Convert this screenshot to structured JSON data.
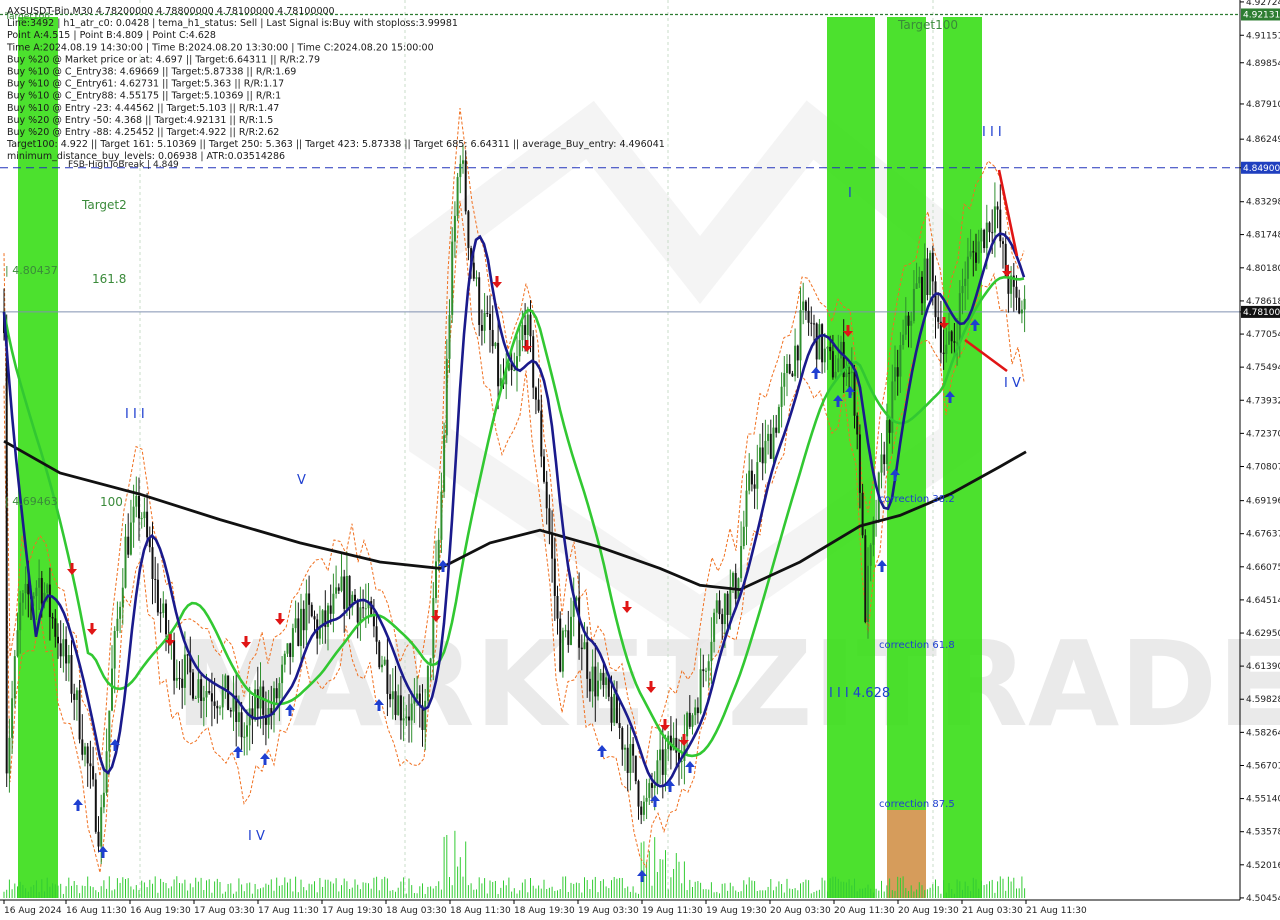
{
  "header": {
    "info_lines": [
      "AXSUSDT-Bin,M30  4.78200000 4.78800000 4.78100000 4.78100000",
      "Line:3492 | h1_atr_c0: 0.0428 | tema_h1_status: Sell | Last Signal is:Buy with stoploss:3.99981",
      "Point A:4.515 | Point B:4.809 | Point C:4.628",
      "Time A:2024.08.19 14:30:00 | Time B:2024.08.20 13:30:00 | Time C:2024.08.20 15:00:00",
      "Buy %20 @ Market price or at: 4.697 || Target:6.64311 || R/R:2.79",
      "Buy %10 @ C_Entry38: 4.69669 || Target:5.87338 || R/R:1.69",
      "Buy %10 @ C_Entry61: 4.62731 || Target:5.363 || R/R:1.17",
      "Buy %10 @ C_Entry88: 4.55175 || Target:5.10369 || R/R:1",
      "Buy %10 @ Entry -23: 4.44562 || Target:5.103 || R/R:1.47",
      "Buy %20 @ Entry -50: 4.368 || Target:4.92131 || R/R:1.5",
      "Buy %20 @ Entry -88: 4.25452 || Target:4.922 || R/R:2.62",
      "Target100: 4.922 || Target 161: 5.10369 || Target 250: 5.363 || Target 423: 5.87338 || Target 685: 6.64311 || average_Buy_entry: 4.496041",
      "minimum_distance_buy_levels: 0.06938 | ATR:0.03514286"
    ]
  },
  "chart_data": {
    "type": "candlestick",
    "symbol": "AXSUSDT-Bin",
    "timeframe": "M30",
    "ylim": [
      4.5045,
      4.9272
    ],
    "y_ticks": [
      "4.92724",
      "4.91151",
      "4.89854",
      "4.87910",
      "4.86249",
      "4.84900",
      "4.83298",
      "4.81748",
      "4.80180",
      "4.78618",
      "4.78100",
      "4.77054",
      "4.75494",
      "4.73932",
      "4.72370",
      "4.70807",
      "4.69196",
      "4.67637",
      "4.66075",
      "4.64514",
      "4.62950",
      "4.61390",
      "4.59828",
      "4.58264",
      "4.56701",
      "4.55140",
      "4.53578",
      "4.52016",
      "4.50454"
    ],
    "x_ticks": [
      "16 Aug 2024",
      "16 Aug 11:30",
      "16 Aug 19:30",
      "17 Aug 03:30",
      "17 Aug 11:30",
      "17 Aug 19:30",
      "18 Aug 03:30",
      "18 Aug 11:30",
      "18 Aug 19:30",
      "19 Aug 03:30",
      "19 Aug 11:30",
      "19 Aug 19:30",
      "20 Aug 03:30",
      "20 Aug 11:30",
      "20 Aug 19:30",
      "21 Aug 03:30",
      "21 Aug 11:30"
    ],
    "current_price": "4.78100",
    "highlighted_prices": [
      {
        "value": 4.92131,
        "label": "4.92131",
        "color": "#2e7d32"
      },
      {
        "value": 4.849,
        "label": "4.84900",
        "color": "#1f3fbf"
      }
    ],
    "levels": [
      {
        "label": "Target100",
        "value": "4.922"
      },
      {
        "label": "FSB-HighToBreak | 4.849",
        "value": "4.849"
      },
      {
        "label": "Target2",
        "value": "4.829"
      },
      {
        "label": "| 4.80437",
        "value": "4.80437"
      },
      {
        "label": "161.8",
        "value": "4.796"
      },
      {
        "label": "| 4.69463",
        "value": "4.69463"
      },
      {
        "label": "100",
        "value": "4.694"
      }
    ],
    "annotations": [
      {
        "text": "I I I",
        "kind": "wave"
      },
      {
        "text": "V",
        "kind": "wave"
      },
      {
        "text": "I V",
        "kind": "wave"
      },
      {
        "text": "I",
        "kind": "wave"
      },
      {
        "text": "I I I",
        "kind": "wave"
      },
      {
        "text": "I V",
        "kind": "wave"
      },
      {
        "text": "I I I 4.628",
        "kind": "wave"
      },
      {
        "text": "correction 38.2",
        "kind": "fib"
      },
      {
        "text": "correction 61.8",
        "kind": "fib"
      },
      {
        "text": "correction 87.5",
        "kind": "fib"
      },
      {
        "text": "Target100",
        "kind": "target"
      }
    ],
    "series": [
      {
        "name": "tema",
        "color": "#1a1a8c"
      },
      {
        "name": "ma_green",
        "color": "#32c832"
      },
      {
        "name": "ma_black",
        "color": "#111111"
      }
    ],
    "watermark": "MARKETZITRADE",
    "colors": {
      "bull": "#2f8f2f",
      "bear": "#111111",
      "band": "#33dd11",
      "salmon": "#ef8f63"
    }
  }
}
